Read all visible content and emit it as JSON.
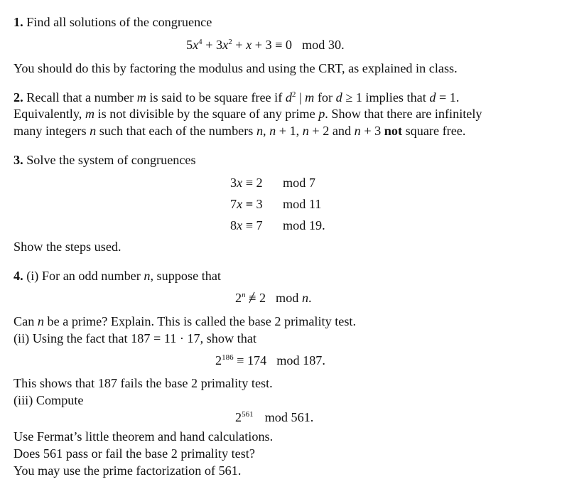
{
  "problems": [
    {
      "number": "1.",
      "lines": [
        "Find all solutions of the congruence",
        "You should do this by factoring the modulus and using the CRT, as explained in class."
      ],
      "display": {
        "lhs_5": "5",
        "x": "x",
        "exp4": "4",
        "plus3": " + 3",
        "exp2": "2",
        "plus_x": " + ",
        "rest": " + 3 ≡ 0",
        "mod": "mod 30."
      }
    },
    {
      "number": "2.",
      "line1_a": "Recall that a number ",
      "m": "m",
      "line1_b": " is said to be square free if ",
      "d": "d",
      "sq": "2",
      "line1_c": " | ",
      "line1_d": " for ",
      "line1_e": " ≥ 1 implies that ",
      "line1_f": " = 1.",
      "line2_a": "Equivalently, ",
      "line2_b": " is not divisible by the square of any prime ",
      "p": "p",
      "line2_c": ". Show that there are infinitely",
      "line3_a": "many integers ",
      "n": "n",
      "line3_b": " such that each of the numbers ",
      "line3_c": ", ",
      "np1": " + 1, ",
      "np2": " + 2 and ",
      "np3": " + 3 ",
      "not": "not",
      "line3_d": " square free."
    },
    {
      "number": "3.",
      "intro": "Solve the system of congruences",
      "system": [
        {
          "lhs_coef": "3",
          "var": "x",
          "rel": " ≡ 2",
          "mod": "mod 7"
        },
        {
          "lhs_coef": "7",
          "var": "x",
          "rel": " ≡ 3",
          "mod": "mod 11"
        },
        {
          "lhs_coef": "8",
          "var": "x",
          "rel": " ≡ 7",
          "mod": "mod 19."
        }
      ],
      "outro": "Show the steps used."
    },
    {
      "number": "4.",
      "i_a": "(i) For an odd number ",
      "n": "n",
      "i_b": ", suppose that",
      "disp1_base": "2",
      "disp1_exp": "n",
      "disp1_rel": "≡",
      "disp1_rhs": " 2",
      "disp1_mod": "mod ",
      "disp1_modvar": "n",
      "disp1_end": ".",
      "can_a": "Can ",
      "can_b": " be a prime? Explain. This is called the base 2 primality test.",
      "ii": "(ii) Using the fact that 187 = 11 · 17, show that",
      "disp2_base": "2",
      "disp2_exp": "186",
      "disp2_rel": " ≡ 174",
      "disp2_mod": "mod 187.",
      "shows": "This shows that 187 fails the base 2 primality test.",
      "iii": "(iii) Compute",
      "disp3_base": "2",
      "disp3_exp": "561",
      "disp3_mod": "mod 561.",
      "fermat": "Use Fermat’s little theorem and hand calculations.",
      "pass": "Does 561 pass or fail the base 2 primality test?",
      "factor": "You may use the prime factorization of 561."
    }
  ]
}
